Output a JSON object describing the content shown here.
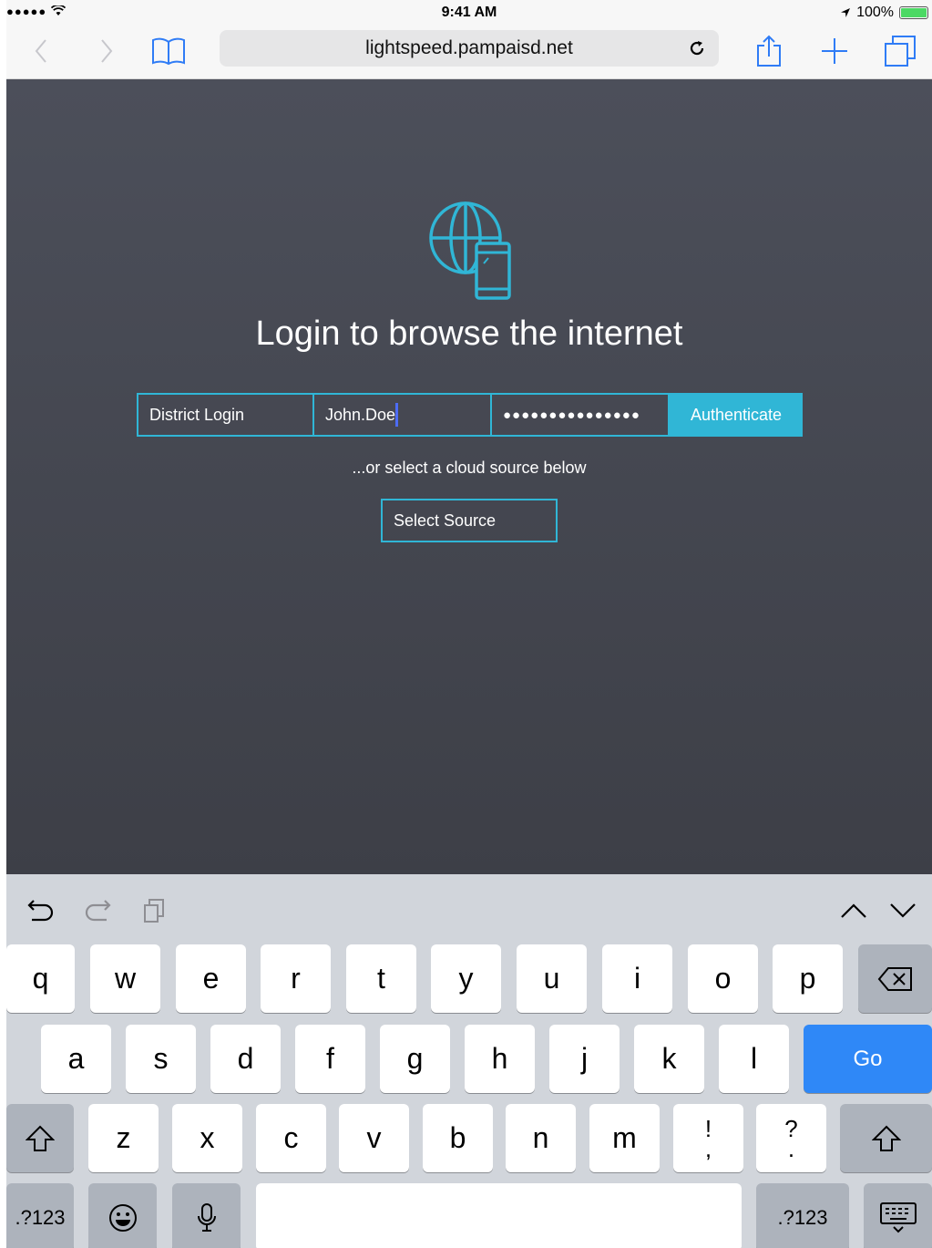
{
  "status_bar": {
    "signal": "●●●●● ",
    "time": "9:41 AM",
    "battery": "100%"
  },
  "browser": {
    "url": "lightspeed.pampaisd.net"
  },
  "page": {
    "headline": "Login to browse the internet",
    "login_select_label": "District Login",
    "username_value": "John.Doe",
    "password_value": "●●●●●●●●●●●●●●●",
    "authenticate_label": "Authenticate",
    "or_text": "...or select a cloud source below",
    "select_source_label": "Select Source"
  },
  "keyboard": {
    "row1": [
      "q",
      "w",
      "e",
      "r",
      "t",
      "y",
      "u",
      "i",
      "o",
      "p"
    ],
    "row2": [
      "a",
      "s",
      "d",
      "f",
      "g",
      "h",
      "j",
      "k",
      "l"
    ],
    "row3": [
      "z",
      "x",
      "c",
      "v",
      "b",
      "n",
      "m"
    ],
    "punct1_top": "!",
    "punct1_bottom": ",",
    "punct2_top": "?",
    "punct2_bottom": ".",
    "go_label": "Go",
    "numbers_label": ".?123"
  },
  "colors": {
    "accent": "#30b6d6",
    "go_key": "#2f88f7",
    "safari_blue": "#2f7cf6"
  }
}
